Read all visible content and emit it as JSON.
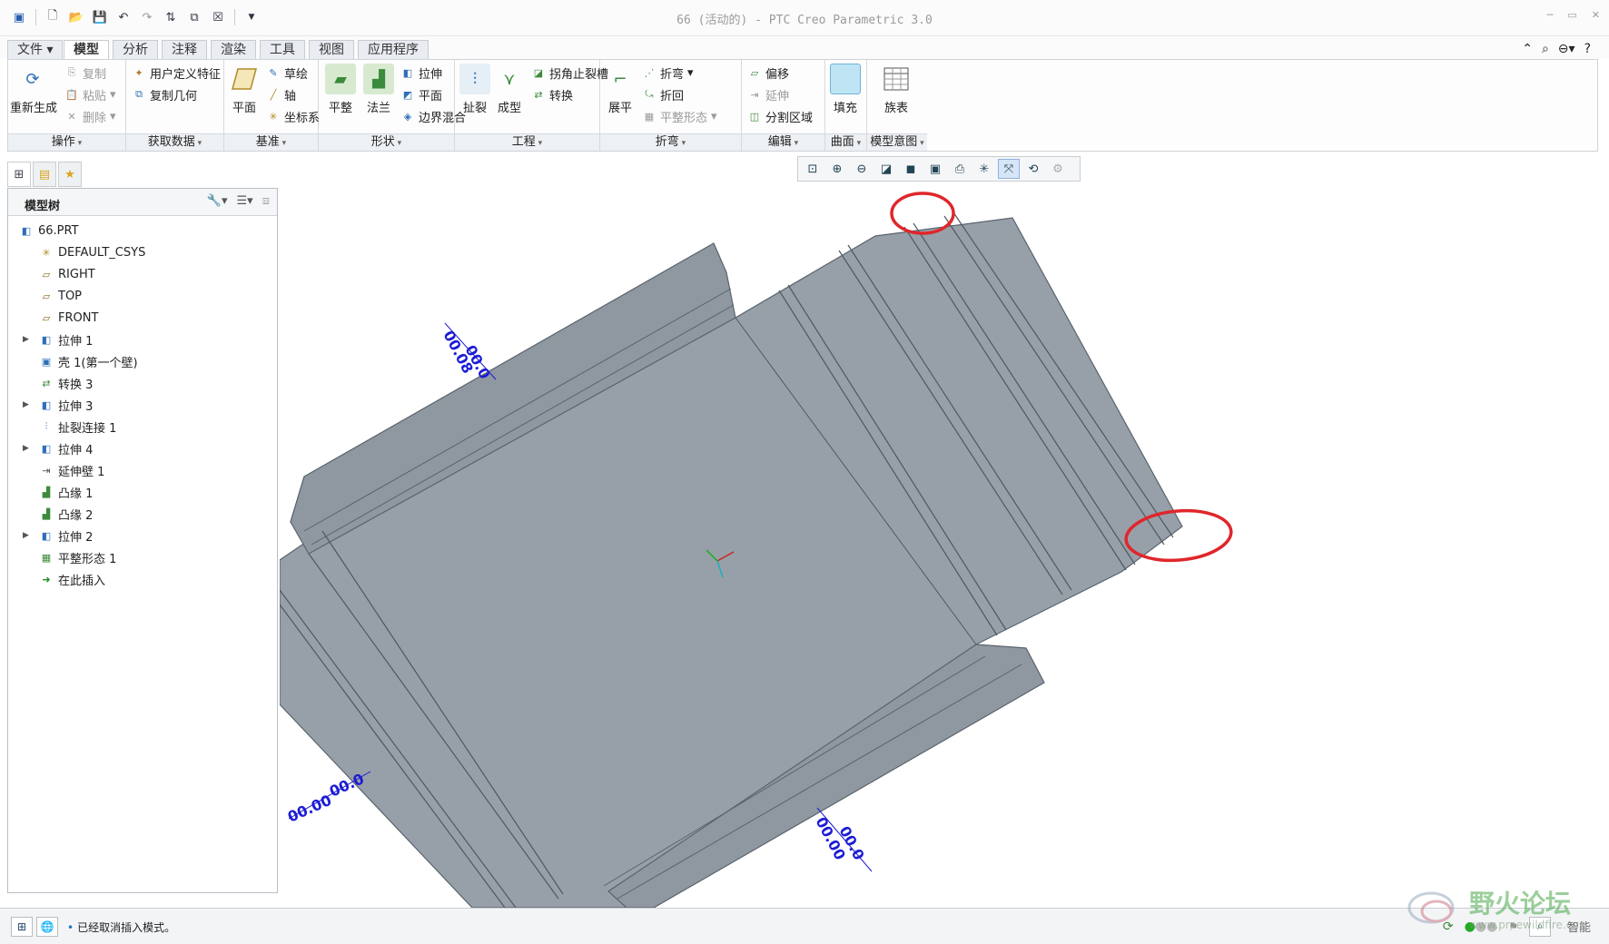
{
  "window": {
    "title": "66 (活动的) - PTC Creo Parametric 3.0"
  },
  "quick_access": {
    "icons": [
      "new-icon",
      "open-icon",
      "save-icon",
      "undo-icon",
      "redo-icon",
      "regenerate-icon",
      "window-icon",
      "close-window-icon",
      "customize-icon"
    ]
  },
  "tabs": [
    {
      "label": "文件",
      "dropdown": true
    },
    {
      "label": "模型",
      "active": true
    },
    {
      "label": "分析"
    },
    {
      "label": "注释"
    },
    {
      "label": "渲染"
    },
    {
      "label": "工具"
    },
    {
      "label": "视图"
    },
    {
      "label": "应用程序"
    }
  ],
  "ribbon": {
    "groups": [
      {
        "label": "操作",
        "items": [
          "重新生成",
          "复制",
          "粘贴",
          "删除"
        ]
      },
      {
        "label": "获取数据",
        "items": [
          "用户定义特征",
          "复制几何"
        ]
      },
      {
        "label": "基准",
        "items": [
          "平面",
          "草绘",
          "轴",
          "坐标系"
        ]
      },
      {
        "label": "形状",
        "items": [
          "平整",
          "法兰",
          "拉伸",
          "平面",
          "边界混合"
        ]
      },
      {
        "label": "工程",
        "items": [
          "扯裂",
          "成型",
          "拐角止裂槽",
          "转换"
        ]
      },
      {
        "label": "折弯",
        "items": [
          "展平",
          "折弯",
          "折回",
          "平整形态"
        ]
      },
      {
        "label": "编辑",
        "items": [
          "偏移",
          "延伸",
          "分割区域"
        ]
      },
      {
        "label": "曲面",
        "items": [
          "填充"
        ]
      },
      {
        "label": "模型意图",
        "items": [
          "族表"
        ]
      }
    ]
  },
  "view_toolbar": {
    "icons": [
      "refit-icon",
      "zoom-in-icon",
      "zoom-out-icon",
      "repaint-icon",
      "display-style-icon",
      "saved-views-icon",
      "view-manager-icon",
      "datum-display-icon",
      "annotation-display-icon",
      "spin-center-icon",
      "model-display-icon"
    ]
  },
  "model_tree": {
    "title": "模型树",
    "items": [
      {
        "label": "66.PRT",
        "icon": "part-icon",
        "expandable": false,
        "indent": 0
      },
      {
        "label": "DEFAULT_CSYS",
        "icon": "csys-icon",
        "expandable": false,
        "indent": 1
      },
      {
        "label": "RIGHT",
        "icon": "datum-plane-icon",
        "expandable": false,
        "indent": 1
      },
      {
        "label": "TOP",
        "icon": "datum-plane-icon",
        "expandable": false,
        "indent": 1
      },
      {
        "label": "FRONT",
        "icon": "datum-plane-icon",
        "expandable": false,
        "indent": 1
      },
      {
        "label": "拉伸 1",
        "icon": "extrude-icon",
        "expandable": true,
        "indent": 1
      },
      {
        "label": "壳 1(第一个壁)",
        "icon": "shell-icon",
        "expandable": false,
        "indent": 1
      },
      {
        "label": "转换 3",
        "icon": "convert-icon",
        "expandable": false,
        "indent": 1
      },
      {
        "label": "拉伸 3",
        "icon": "extrude-icon",
        "expandable": true,
        "indent": 1
      },
      {
        "label": "扯裂连接 1",
        "icon": "rip-icon",
        "expandable": false,
        "indent": 1
      },
      {
        "label": "拉伸 4",
        "icon": "extrude-icon",
        "expandable": true,
        "indent": 1
      },
      {
        "label": "延伸壁 1",
        "icon": "extend-icon",
        "expandable": false,
        "indent": 1
      },
      {
        "label": "凸缘 1",
        "icon": "flange-icon",
        "expandable": false,
        "indent": 1
      },
      {
        "label": "凸缘 2",
        "icon": "flange-icon",
        "expandable": false,
        "indent": 1
      },
      {
        "label": "拉伸 2",
        "icon": "extrude-icon",
        "expandable": true,
        "indent": 1
      },
      {
        "label": "平整形态 1",
        "icon": "flat-state-icon",
        "expandable": false,
        "indent": 1
      },
      {
        "label": "在此插入",
        "icon": "insert-here-icon",
        "expandable": false,
        "indent": 1
      }
    ]
  },
  "graphics": {
    "dimensions": [
      "00.08",
      "00.0",
      "00.00",
      "00.0",
      "00.00",
      "00.0"
    ],
    "colors": {
      "sheet_face": "#97a0a9",
      "sheet_edge": "#5a636c",
      "highlight": "#e0262b",
      "dimension": "#1b1bd6"
    }
  },
  "status": {
    "message": "已经取消插入模式。",
    "filter": "智能",
    "icons": [
      "regen-status-icon",
      "status-lights-icon",
      "flag-icon",
      "find-icon"
    ]
  },
  "watermark": {
    "text": "野火论坛",
    "url": "www.proewildfire.cn"
  }
}
